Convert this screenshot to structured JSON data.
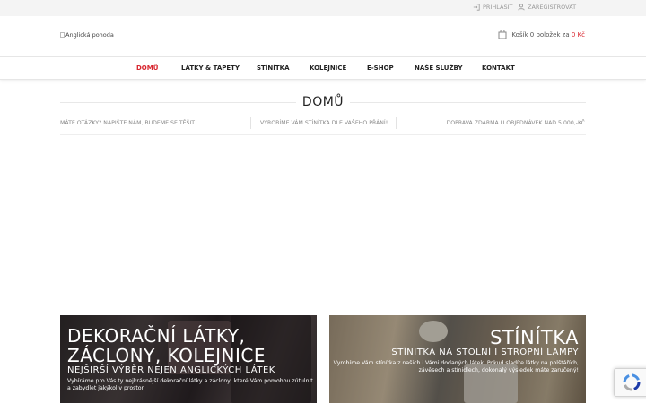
{
  "topbar": {
    "login_label": "Přihlásit",
    "register_label": "Zaregistrovat"
  },
  "header": {
    "logo_alt": "Anglická pohoda",
    "cart_text": "Košík 0 položek za",
    "cart_price": "0 Kč"
  },
  "nav": {
    "items": [
      {
        "label": "Domů",
        "active": true
      },
      {
        "label": "Látky & Tapety"
      },
      {
        "label": "Stínítka"
      },
      {
        "label": "Kolejnice"
      },
      {
        "label": "E-shop"
      },
      {
        "label": "Naše služby"
      },
      {
        "label": "Kontakt"
      }
    ]
  },
  "page": {
    "title": "DOMŮ"
  },
  "info_bar": {
    "left": "Máte otázky? Napište nám, budeme se těšit!",
    "center": "Vyrobíme Vám stínítka dle Vašeho přání!",
    "right": "Doprava zdarma u objednávek nad 5.000,-Kč"
  },
  "banners": {
    "left": {
      "title_line1": "Dekorační látky,",
      "title_line2": "záclony, kolejnice",
      "subtitle": "Nejširší výběr nejen anglických látek",
      "text_line1": "Vybíráme pro Vás ty nejkrásnější dekorační látky a záclony, které Vám pomohou zútulnit",
      "text_line2": "a zabydlet jakýkoliv prostor."
    },
    "right": {
      "title": "Stínítka",
      "subtitle": "Stínítka na stolní i stropní lampy",
      "text_line1": "Vyrobíme Vám stínítka z našich i Vámi dodaných látek. Pokud sladíte látky na polštářích,",
      "text_line2": "závěsech a stínidlech, dokonalý výsledek máte zaručený!"
    }
  },
  "colors": {
    "accent": "#d8262f",
    "topbar_bg": "#f4f4f4"
  }
}
